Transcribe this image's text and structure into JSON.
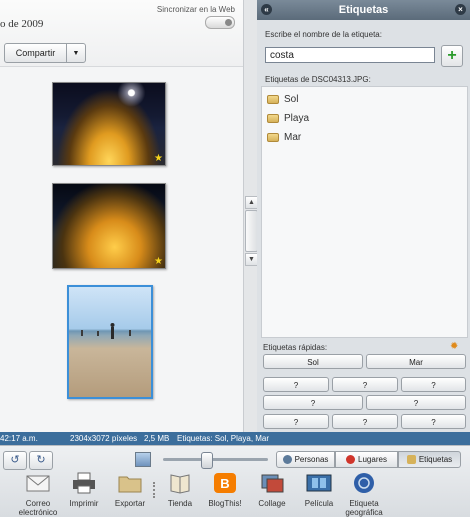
{
  "header": {
    "date_text": "o de 2009",
    "sync_label": "Sincronizar en la Web",
    "share_label": "Compartir"
  },
  "photos": {
    "items": [
      {
        "name": "photo-night-coast-1",
        "star": "★"
      },
      {
        "name": "photo-night-coast-2",
        "star": "★"
      },
      {
        "name": "photo-beach-day",
        "star": ""
      }
    ]
  },
  "tags_panel": {
    "title": "Etiquetas",
    "input_label": "Escribe el nombre de la etiqueta:",
    "input_value": "costa",
    "add_symbol": "+",
    "file_tags_label": "Etiquetas de DSC04313.JPG:",
    "tags": [
      "Sol",
      "Playa",
      "Mar"
    ],
    "quick_label": "Etiquetas rápidas:",
    "quick_tags": [
      "Sol",
      "Mar",
      "?",
      "?",
      "?",
      "?",
      "?",
      "?",
      "?",
      "?",
      "?"
    ]
  },
  "status_bar": {
    "time": "42:17 a.m.",
    "dimensions": "2304x3072 píxeles",
    "size": "2,5 MB",
    "tags": "Etiquetas: Sol, Playa, Mar"
  },
  "toolbar": {
    "rotate_left": "↺",
    "rotate_right": "↻",
    "view_tabs": [
      "Personas",
      "Lugares",
      "Etiquetas"
    ],
    "tools": [
      {
        "label": "Correo electrónico",
        "icon": "envelope-icon"
      },
      {
        "label": "Imprimir",
        "icon": "printer-icon"
      },
      {
        "label": "Exportar",
        "icon": "folder-icon"
      },
      {
        "label": "Tienda",
        "icon": "shop-icon"
      },
      {
        "label": "BlogThis!",
        "icon": "blogger-icon"
      },
      {
        "label": "Collage",
        "icon": "collage-icon"
      },
      {
        "label": "Película",
        "icon": "film-icon"
      },
      {
        "label": "Etiqueta geográfica",
        "icon": "globe-icon"
      }
    ]
  },
  "colors": {
    "status_bar": "#3c6e9c",
    "panel_header": "#6a7a89",
    "selection": "#3b8fd8",
    "add_green": "#2a9a2a",
    "star": "#f5d31a"
  }
}
